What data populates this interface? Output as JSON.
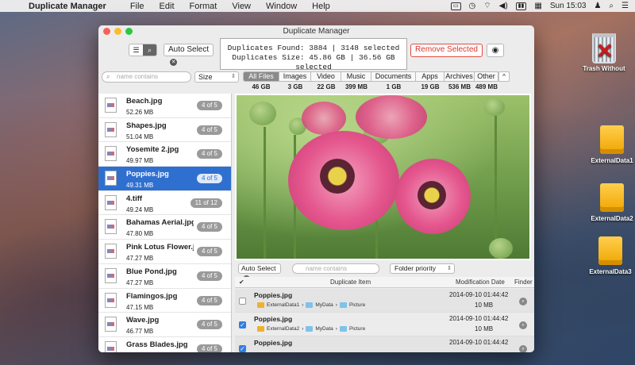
{
  "menubar": {
    "app_name": "Duplicate Manager",
    "menus": [
      "File",
      "Edit",
      "Format",
      "View",
      "Window",
      "Help"
    ],
    "clock": "Sun 15:03"
  },
  "desktop": {
    "trash_label": "Trash Without",
    "drives": [
      "ExternalData1",
      "ExternalData2",
      "ExternalData3"
    ]
  },
  "window": {
    "title": "Duplicate Manager",
    "autoselect_label": "Auto Select",
    "stats_line1": "Duplicates Found: 3884 | 3148 selected",
    "stats_line2": "Duplicates Size: 45.86 GB | 36.56 GB selected",
    "remove_label": "Remove Selected",
    "search_placeholder": "name contains",
    "sort_label": "Size",
    "tabs": [
      {
        "label": "All Files",
        "size": "46 GB"
      },
      {
        "label": "Images",
        "size": "3 GB"
      },
      {
        "label": "Video",
        "size": "22 GB"
      },
      {
        "label": "Music",
        "size": "399 MB"
      },
      {
        "label": "Documents",
        "size": "1 GB"
      },
      {
        "label": "Apps",
        "size": "19 GB"
      },
      {
        "label": "Archives",
        "size": "536 MB"
      },
      {
        "label": "Other",
        "size": "489 MB"
      }
    ]
  },
  "files": [
    {
      "name": "Beach.jpg",
      "size": "52.26 MB",
      "count": "4 of 5"
    },
    {
      "name": "Shapes.jpg",
      "size": "51.04 MB",
      "count": "4 of 5"
    },
    {
      "name": "Yosemite 2.jpg",
      "size": "49.97 MB",
      "count": "4 of 5"
    },
    {
      "name": "Poppies.jpg",
      "size": "49.31 MB",
      "count": "4 of 5"
    },
    {
      "name": "4.tiff",
      "size": "49.24 MB",
      "count": "11 of 12"
    },
    {
      "name": "Bahamas Aerial.jpg",
      "size": "47.80 MB",
      "count": "4 of 5"
    },
    {
      "name": "Pink Lotus Flower.j...",
      "size": "47.27 MB",
      "count": "4 of 5"
    },
    {
      "name": "Blue Pond.jpg",
      "size": "47.27 MB",
      "count": "4 of 5"
    },
    {
      "name": "Flamingos.jpg",
      "size": "47.15 MB",
      "count": "4 of 5"
    },
    {
      "name": "Wave.jpg",
      "size": "46.77 MB",
      "count": "4 of 5"
    },
    {
      "name": "Grass Blades.jpg",
      "size": "",
      "count": "4 of 5"
    }
  ],
  "table": {
    "autoselect_label": "Auto Select",
    "search_placeholder": "name contains",
    "priority_label": "Folder priority",
    "headers": {
      "check": "✔",
      "item": "Duplicate Item",
      "date": "Modification Date",
      "finder": "Finder"
    },
    "rows": [
      {
        "name": "Poppies.jpg",
        "drive": "ExternalData1",
        "folder": "MyData",
        "sub": "Picture",
        "date": "2014-09-10 01:44:42",
        "size": "10 MB",
        "checked": false
      },
      {
        "name": "Poppies.jpg",
        "drive": "ExternalData2",
        "folder": "MyData",
        "sub": "Picture",
        "date": "2014-09-10 01:44:42",
        "size": "10 MB",
        "checked": true
      },
      {
        "name": "Poppies.jpg",
        "drive": "",
        "folder": "",
        "sub": "",
        "date": "2014-09-10 01:44:42",
        "size": "",
        "checked": true
      }
    ]
  },
  "colors": {
    "selection": "#2f6fd0",
    "remove_button": "#e34a3e",
    "checkbox": "#2f7ee3"
  }
}
